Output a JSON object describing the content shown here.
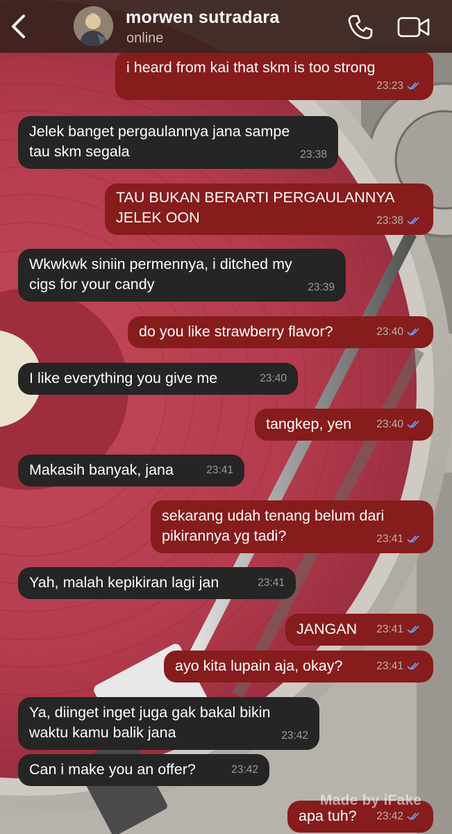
{
  "header": {
    "contact_name": "morwen sutradara",
    "status": "online",
    "icons": {
      "back": "chevron-left-icon",
      "call": "phone-icon",
      "video": "video-camera-icon"
    }
  },
  "messages": [
    {
      "direction": "outgoing",
      "text": "i heard from kai that skm is too strong",
      "time": "23:23",
      "read": true
    },
    {
      "direction": "incoming",
      "text": "Jelek banget pergaulannya jana sampe\ntau skm segala",
      "time": "23:38"
    },
    {
      "direction": "outgoing",
      "text": "TAU BUKAN BERARTI PERGAULANNYA\nJELEK OON",
      "time": "23:38",
      "read": true
    },
    {
      "direction": "incoming",
      "text": "Wkwkwk siniin permennya, i ditched my\ncigs for your candy",
      "time": "23:39"
    },
    {
      "direction": "outgoing",
      "text": "do you like strawberry flavor?",
      "time": "23:40",
      "read": true
    },
    {
      "direction": "incoming",
      "text": "I like everything you give me",
      "time": "23:40"
    },
    {
      "direction": "outgoing",
      "text": "tangkep, yen",
      "time": "23:40",
      "read": true
    },
    {
      "direction": "incoming",
      "text": "Makasih banyak, jana",
      "time": "23:41"
    },
    {
      "direction": "outgoing",
      "text": "sekarang udah tenang belum dari\npikirannya yg tadi?",
      "time": "23:41",
      "read": true
    },
    {
      "direction": "incoming",
      "text": "Yah, malah kepikiran lagi jan",
      "time": "23:41"
    },
    {
      "direction": "outgoing",
      "text": "JANGAN",
      "time": "23:41",
      "read": true
    },
    {
      "direction": "outgoing",
      "text": "ayo kita lupain aja, okay?",
      "time": "23:41",
      "read": true
    },
    {
      "direction": "incoming",
      "text": "Ya, diinget inget juga gak bakal bikin\nwaktu kamu balik jana",
      "time": "23:42"
    },
    {
      "direction": "incoming",
      "text": "Can i make you an offer?",
      "time": "23:42"
    },
    {
      "direction": "outgoing",
      "text": "apa tuh?",
      "time": "23:42",
      "read": true
    }
  ],
  "watermark": "Made by iFake",
  "colors": {
    "header_bg": "#3a221e",
    "outgoing_bubble": "#871c1c",
    "incoming_bubble": "#252525",
    "read_ticks": "#6e9ff0",
    "vinyl": "#b03a4b"
  }
}
